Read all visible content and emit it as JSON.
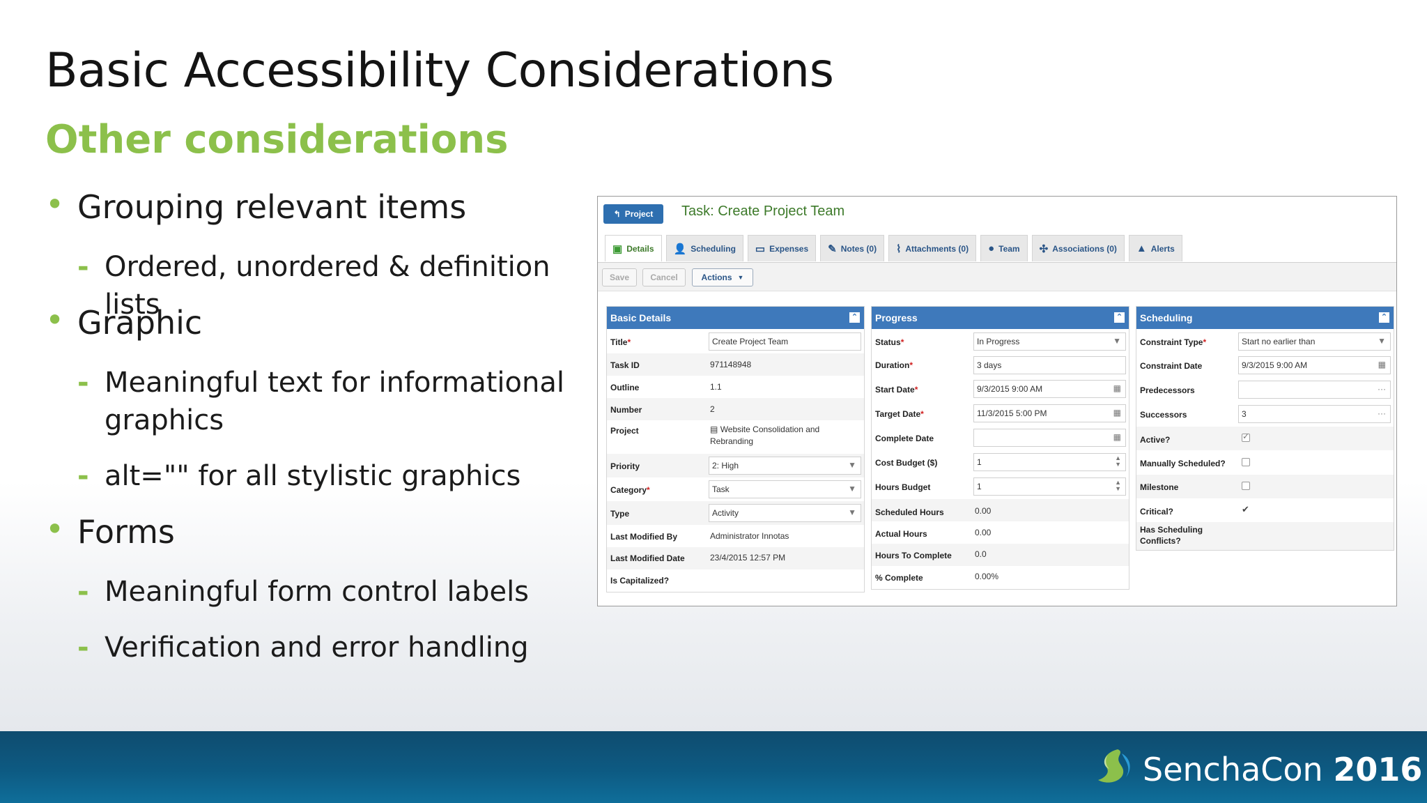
{
  "slide": {
    "title": "Basic Accessibility Considerations",
    "subtitle": "Other considerations",
    "bullets": [
      {
        "text": "Grouping relevant items",
        "subs": [
          "Ordered, unordered & definition lists"
        ]
      },
      {
        "text": "Graphic",
        "subs": [
          "Meaningful text for informational graphics",
          "alt=\"\" for all stylistic graphics"
        ]
      },
      {
        "text": "Forms",
        "subs": [
          "Meaningful form control labels",
          "Verification and error handling"
        ]
      }
    ],
    "accent_color": "#8cc04b"
  },
  "app": {
    "project_button": "Project",
    "task_title": "Task: Create Project Team",
    "tabs": [
      "Details",
      "Scheduling",
      "Expenses",
      "Notes (0)",
      "Attachments (0)",
      "Team",
      "Associations (0)",
      "Alerts"
    ],
    "toolbar": {
      "save": "Save",
      "cancel": "Cancel",
      "actions": "Actions"
    },
    "basic": {
      "header": "Basic Details",
      "title_label": "Title",
      "title_value": "Create Project Team",
      "taskid_label": "Task ID",
      "taskid_value": "971148948",
      "outline_label": "Outline",
      "outline_value": "1.1",
      "number_label": "Number",
      "number_value": "2",
      "project_label": "Project",
      "project_value_1": "Website Consolidation and",
      "project_value_2": "Rebranding",
      "priority_label": "Priority",
      "priority_value": "2: High",
      "category_label": "Category",
      "category_value": "Task",
      "type_label": "Type",
      "type_value": "Activity",
      "lmb_label": "Last Modified By",
      "lmb_value": "Administrator Innotas",
      "lmd_label": "Last Modified Date",
      "lmd_value": "23/4/2015 12:57 PM",
      "cap_label": "Is Capitalized?"
    },
    "progress": {
      "header": "Progress",
      "status_label": "Status",
      "status_value": "In Progress",
      "duration_label": "Duration",
      "duration_value": "3 days",
      "start_label": "Start Date",
      "start_value": "9/3/2015 9:00 AM",
      "target_label": "Target Date",
      "target_value": "11/3/2015 5:00 PM",
      "complete_label": "Complete Date",
      "cost_label": "Cost Budget ($)",
      "cost_value": "1",
      "hours_label": "Hours Budget",
      "hours_value": "1",
      "sched_label": "Scheduled Hours",
      "sched_value": "0.00",
      "actual_label": "Actual Hours",
      "actual_value": "0.00",
      "htc_label": "Hours To Complete",
      "htc_value": "0.0",
      "pct_label": "% Complete",
      "pct_value": "0.00%"
    },
    "scheduling": {
      "header": "Scheduling",
      "ctype_label": "Constraint Type",
      "ctype_value": "Start no earlier than",
      "cdate_label": "Constraint Date",
      "cdate_value": "9/3/2015 9:00 AM",
      "pred_label": "Predecessors",
      "succ_label": "Successors",
      "succ_value": "3",
      "active_label": "Active?",
      "manual_label": "Manually Scheduled?",
      "milestone_label": "Milestone",
      "critical_label": "Critical?",
      "conflicts_label_1": "Has Scheduling",
      "conflicts_label_2": "Conflicts?"
    },
    "colors": {
      "header_blue": "#3e79bb",
      "title_green": "#3d7a2a",
      "required_red": "#d02020"
    }
  },
  "footer": {
    "brand": "SenchaCon",
    "year": "2016"
  }
}
